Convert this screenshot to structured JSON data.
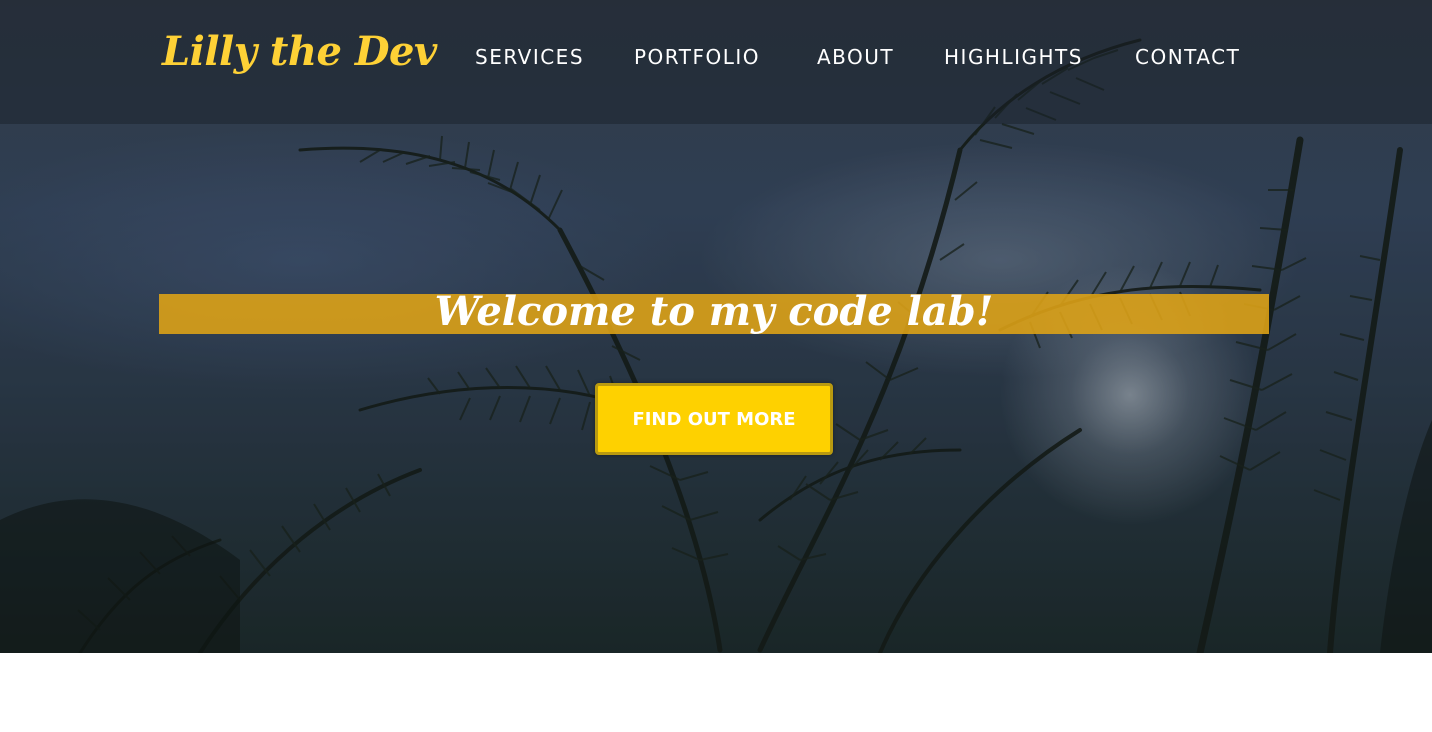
{
  "brand": {
    "name": "Lilly the Dev",
    "color": "#fed136"
  },
  "nav": {
    "items": [
      {
        "label": "SERVICES"
      },
      {
        "label": "PORTFOLIO"
      },
      {
        "label": "ABOUT"
      },
      {
        "label": "HIGHLIGHTS"
      },
      {
        "label": "CONTACT"
      }
    ]
  },
  "hero": {
    "heading": "Welcome to my code lab!",
    "cta_label": "FIND OUT MORE",
    "accent_color": "#fed100",
    "band_color": "#e0a416",
    "background": "fern-canopy-photo"
  }
}
